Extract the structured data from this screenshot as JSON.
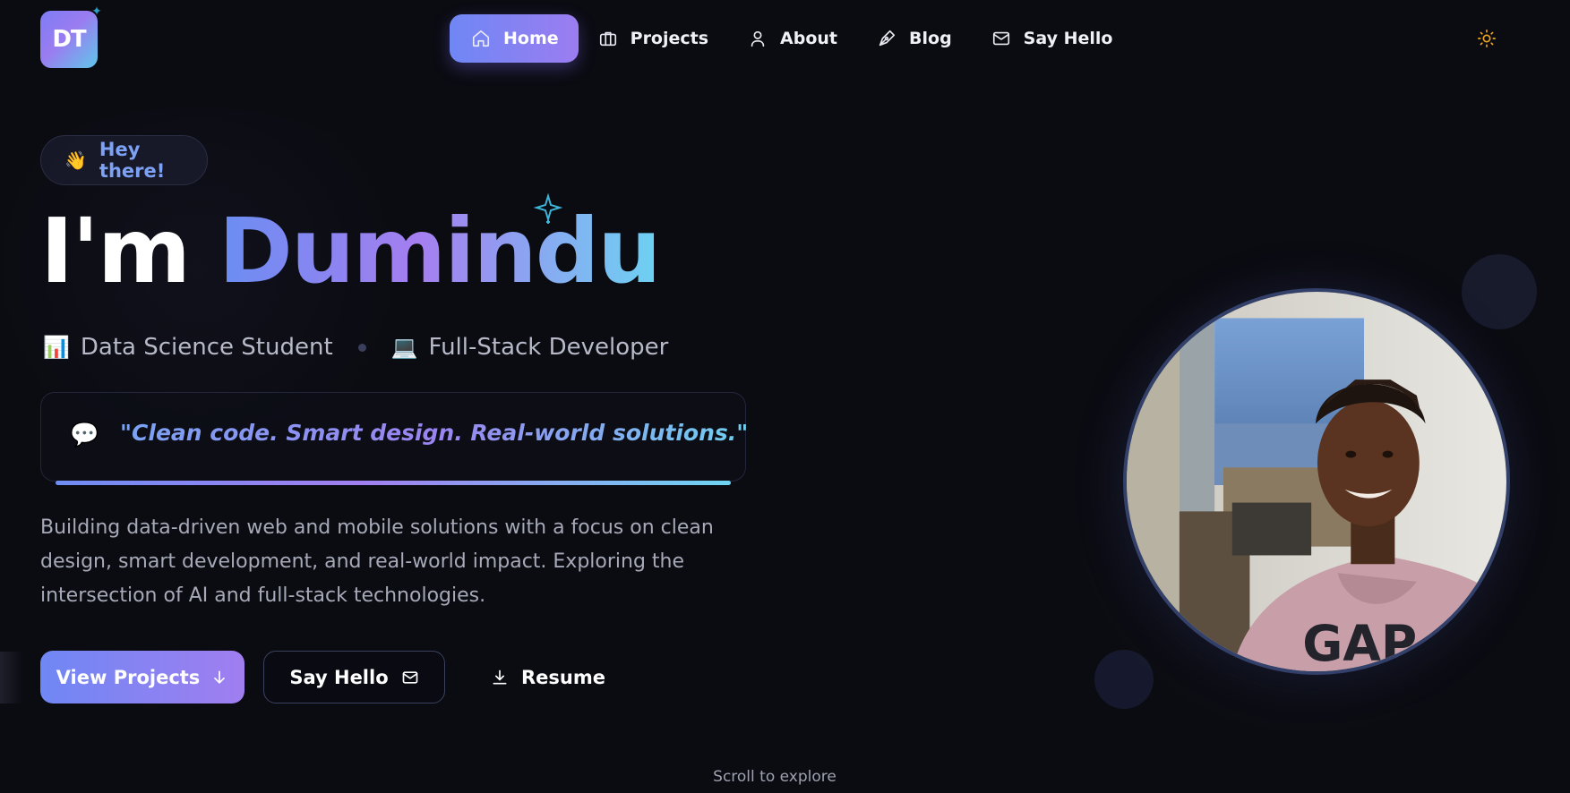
{
  "logo": {
    "text": "DT"
  },
  "nav": {
    "items": [
      {
        "label": "Home",
        "icon": "home-icon",
        "active": true
      },
      {
        "label": "Projects",
        "icon": "briefcase-icon",
        "active": false
      },
      {
        "label": "About",
        "icon": "user-icon",
        "active": false
      },
      {
        "label": "Blog",
        "icon": "pen-icon",
        "active": false
      },
      {
        "label": "Say Hello",
        "icon": "mail-icon",
        "active": false
      }
    ],
    "theme_toggle_icon": "sun-icon"
  },
  "hero": {
    "badge": {
      "emoji": "👋",
      "text": "Hey there!"
    },
    "headline_prefix": "I'm",
    "headline_name": "Dumindu",
    "roles": [
      {
        "emoji": "📊",
        "label": "Data Science Student"
      },
      {
        "emoji": "💻",
        "label": "Full-Stack Developer"
      }
    ],
    "quote": {
      "emoji": "💬",
      "text": "\"Clean code. Smart design. Real-world solutions.\""
    },
    "description": "Building data-driven web and mobile solutions with a focus on clean design, smart development, and real-world impact. Exploring the intersection of AI and full-stack technologies.",
    "buttons": {
      "primary": "View Projects",
      "secondary": "Say Hello",
      "tertiary": "Resume"
    },
    "scroll_hint": "Scroll to explore"
  },
  "colors": {
    "background": "#0b0b12",
    "accent_start": "#6f87f4",
    "accent_end": "#a07ef0",
    "accent_cyan": "#6fd4f2",
    "sun": "#f2a81d"
  }
}
